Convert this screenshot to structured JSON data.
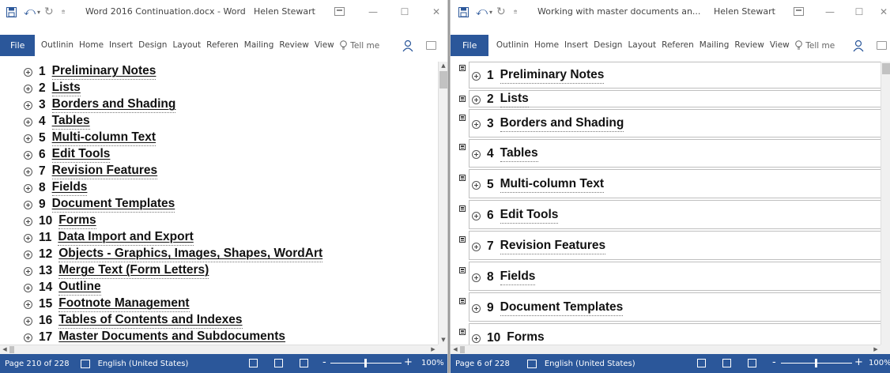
{
  "windows": [
    {
      "title": "Word 2016 Continuation.docx - Word",
      "user": "Helen Stewart",
      "tabs": [
        "File",
        "Outlinin",
        "Home",
        "Insert",
        "Design",
        "Layout",
        "Referen",
        "Mailing",
        "Review",
        "View"
      ],
      "tell_me": "Tell me",
      "outline": [
        {
          "num": "1",
          "text": "Preliminary Notes"
        },
        {
          "num": "2",
          "text": "Lists"
        },
        {
          "num": "3",
          "text": "Borders and Shading"
        },
        {
          "num": "4",
          "text": "Tables"
        },
        {
          "num": "5",
          "text": "Multi-column Text"
        },
        {
          "num": "6",
          "text": "Edit Tools"
        },
        {
          "num": "7",
          "text": "Revision Features"
        },
        {
          "num": "8",
          "text": "Fields"
        },
        {
          "num": "9",
          "text": "Document Templates"
        },
        {
          "num": "10",
          "text": "Forms"
        },
        {
          "num": "11",
          "text": "Data Import and Export"
        },
        {
          "num": "12",
          "text": "Objects - Graphics, Images, Shapes, WordArt"
        },
        {
          "num": "13",
          "text": "Merge Text (Form Letters)"
        },
        {
          "num": "14",
          "text": "Outline"
        },
        {
          "num": "15",
          "text": "Footnote Management"
        },
        {
          "num": "16",
          "text": "Tables of Contents and Indexes"
        },
        {
          "num": "17",
          "text": "Master Documents and Subdocuments"
        }
      ],
      "status": {
        "page": "Page 210 of 228",
        "language": "English (United States)",
        "zoom": "100%"
      }
    },
    {
      "title": "Working with master documents an...",
      "user": "Helen Stewart",
      "tabs": [
        "File",
        "Outlinin",
        "Home",
        "Insert",
        "Design",
        "Layout",
        "Referen",
        "Mailing",
        "Review",
        "View"
      ],
      "tell_me": "Tell me",
      "outline": [
        {
          "num": "1",
          "text": "Preliminary Notes"
        },
        {
          "num": "2",
          "text": "Lists"
        },
        {
          "num": "3",
          "text": "Borders and Shading"
        },
        {
          "num": "4",
          "text": "Tables"
        },
        {
          "num": "5",
          "text": "Multi-column Text"
        },
        {
          "num": "6",
          "text": "Edit Tools"
        },
        {
          "num": "7",
          "text": "Revision Features"
        },
        {
          "num": "8",
          "text": "Fields"
        },
        {
          "num": "9",
          "text": "Document Templates"
        },
        {
          "num": "10",
          "text": "Forms"
        }
      ],
      "status": {
        "page": "Page 6 of 228",
        "language": "English (United States)",
        "zoom": "100%"
      }
    }
  ],
  "colors": {
    "accent": "#2b579a",
    "text": "#111111"
  }
}
